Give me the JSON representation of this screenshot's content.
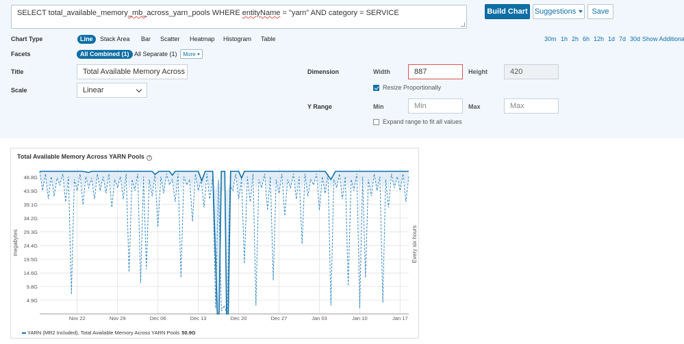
{
  "query": {
    "prefix": "SELECT total_available_memory",
    "squiggle1": "_mb_",
    "middle": "across_yarn_pools WHERE ",
    "squiggle2": "entityName",
    "suffix": " = \"yarn\" AND category = SERVICE"
  },
  "toolbar": {
    "build_label": "Build Chart",
    "suggestions_label": "Suggestions",
    "save_label": "Save"
  },
  "chart_type": {
    "label": "Chart Type",
    "options": [
      "Line",
      "Stack Area",
      "Bar",
      "Scatter",
      "Heatmap",
      "Histogram",
      "Table"
    ],
    "selected": "Line"
  },
  "time_ranges": [
    "30m",
    "1h",
    "2h",
    "6h",
    "12h",
    "1d",
    "7d",
    "30d"
  ],
  "show_additional": "Show Additional",
  "facets": {
    "label": "Facets",
    "combined": "All Combined (1)",
    "separate": "All Separate (1)",
    "more": "More"
  },
  "title_field": {
    "label": "Title",
    "value": "Total Available Memory Across YA"
  },
  "scale_field": {
    "label": "Scale",
    "value": "Linear"
  },
  "dimension": {
    "label": "Dimension",
    "width_label": "Width",
    "width_value": "887",
    "height_label": "Height",
    "height_value": "420",
    "resize_label": "Resize Proportionally",
    "resize_checked": true
  },
  "y_range": {
    "label": "Y Range",
    "min_label": "Min",
    "min_placeholder": "Min",
    "max_label": "Max",
    "max_placeholder": "Max",
    "expand_label": "Expand range to fit all values",
    "expand_checked": false
  },
  "colors": {
    "accent": "#0e6fa5",
    "panel_bg": "#f1f7fd",
    "invalid": "#d9534f"
  },
  "chart_data": {
    "type": "line",
    "title": "Total Available Memory Across YARN Pools",
    "ylabel": "megabytes",
    "right_label": "Every six hours",
    "y_ticks": [
      "4.9G",
      "9.8G",
      "14.6G",
      "19.5G",
      "24.4G",
      "29.3G",
      "34.2G",
      "39.1G",
      "43.9G",
      "48.8G"
    ],
    "y_tick_values": [
      4.9,
      9.8,
      14.6,
      19.5,
      24.4,
      29.3,
      34.2,
      39.1,
      43.9,
      48.8
    ],
    "ylim": [
      0,
      52
    ],
    "x_ticks": [
      "Nov 22",
      "Nov 29",
      "Dec 06",
      "Dec 13",
      "Dec 20",
      "Dec 27",
      "Jan 03",
      "Jan 10",
      "Jan 17"
    ],
    "x_tick_days": [
      22,
      29,
      36,
      43,
      50,
      57,
      64,
      71,
      78
    ],
    "xlim_days": [
      15.5,
      79.5
    ],
    "series": [
      {
        "name": "YARN (MR2 Included), Total Available Memory Across YARN Pools",
        "line": "max",
        "points": [
          [
            15.5,
            50.9
          ],
          [
            23,
            50.9
          ],
          [
            24,
            50.5
          ],
          [
            24.5,
            50.9
          ],
          [
            35,
            50.9
          ],
          [
            35.5,
            49.8
          ],
          [
            36.2,
            50.9
          ],
          [
            38,
            50.9
          ],
          [
            38.5,
            49.5
          ],
          [
            39,
            50.9
          ],
          [
            43,
            50.9
          ],
          [
            43.6,
            47.5
          ],
          [
            44.2,
            50.9
          ],
          [
            45.5,
            50.9
          ],
          [
            46.3,
            0
          ],
          [
            46.6,
            0
          ],
          [
            47,
            50.9
          ],
          [
            47.6,
            50.9
          ],
          [
            47.9,
            0
          ],
          [
            48.2,
            0
          ],
          [
            48.6,
            50.9
          ],
          [
            50,
            50.9
          ],
          [
            50.5,
            48.5
          ],
          [
            51,
            50.9
          ],
          [
            65,
            50.9
          ],
          [
            66,
            48
          ],
          [
            66.8,
            50.9
          ],
          [
            79.5,
            50.9
          ]
        ]
      },
      {
        "name": "Minimum",
        "line": "min-dashed",
        "points": [
          [
            15.5,
            50.9
          ],
          [
            16,
            44
          ],
          [
            16.5,
            50
          ],
          [
            17,
            41
          ],
          [
            17.5,
            49
          ],
          [
            18,
            42
          ],
          [
            18.5,
            48.5
          ],
          [
            19,
            46
          ],
          [
            19.5,
            50
          ],
          [
            20,
            40
          ],
          [
            20.5,
            49
          ],
          [
            21,
            7
          ],
          [
            21.5,
            48
          ],
          [
            22,
            44
          ],
          [
            22.5,
            50
          ],
          [
            23,
            39
          ],
          [
            23.5,
            49
          ],
          [
            24,
            45
          ],
          [
            24.5,
            48.5
          ],
          [
            25,
            41
          ],
          [
            25.5,
            50
          ],
          [
            26,
            44
          ],
          [
            26.5,
            49
          ],
          [
            27,
            43
          ],
          [
            27.5,
            50
          ],
          [
            28,
            38
          ],
          [
            28.5,
            48
          ],
          [
            29,
            45
          ],
          [
            29.5,
            49
          ],
          [
            30,
            41
          ],
          [
            30.5,
            50
          ],
          [
            31,
            15
          ],
          [
            31.5,
            48
          ],
          [
            32,
            44
          ],
          [
            32.5,
            50
          ],
          [
            33,
            11
          ],
          [
            33.5,
            49
          ],
          [
            34,
            16
          ],
          [
            34.5,
            48
          ],
          [
            35,
            42
          ],
          [
            35.5,
            50
          ],
          [
            36,
            31
          ],
          [
            36.5,
            49
          ],
          [
            37,
            43
          ],
          [
            37.5,
            50
          ],
          [
            38,
            46
          ],
          [
            38.5,
            48
          ],
          [
            39,
            40
          ],
          [
            39.5,
            50
          ],
          [
            40,
            13
          ],
          [
            40.5,
            49
          ],
          [
            41,
            46
          ],
          [
            41.5,
            48
          ],
          [
            42,
            33
          ],
          [
            42.5,
            50
          ],
          [
            43,
            44
          ],
          [
            43.5,
            48
          ],
          [
            44,
            38
          ],
          [
            44.5,
            50
          ],
          [
            45,
            41
          ],
          [
            45.5,
            49
          ],
          [
            46,
            2
          ],
          [
            46.5,
            48
          ],
          [
            47,
            1
          ],
          [
            47.5,
            3
          ],
          [
            48,
            0
          ],
          [
            48.5,
            46
          ],
          [
            49,
            44
          ],
          [
            49.5,
            50
          ],
          [
            50,
            41
          ],
          [
            50.5,
            48
          ],
          [
            51,
            18
          ],
          [
            51.5,
            49
          ],
          [
            52,
            40
          ],
          [
            52.5,
            50
          ],
          [
            53,
            3
          ],
          [
            53.5,
            48
          ],
          [
            54,
            45
          ],
          [
            54.5,
            50
          ],
          [
            55,
            37
          ],
          [
            55.5,
            49
          ],
          [
            56,
            12
          ],
          [
            56.5,
            48
          ],
          [
            57,
            43
          ],
          [
            57.5,
            50
          ],
          [
            58,
            35
          ],
          [
            58.5,
            48
          ],
          [
            59,
            45
          ],
          [
            59.5,
            50
          ],
          [
            60,
            41
          ],
          [
            60.5,
            49
          ],
          [
            61,
            25
          ],
          [
            61.5,
            50
          ],
          [
            62,
            42
          ],
          [
            62.5,
            48
          ],
          [
            63,
            46
          ],
          [
            63.5,
            50
          ],
          [
            64,
            37
          ],
          [
            64.5,
            49
          ],
          [
            65,
            43
          ],
          [
            65.5,
            50
          ],
          [
            66,
            3
          ],
          [
            66.5,
            48
          ],
          [
            67,
            45
          ],
          [
            67.5,
            50
          ],
          [
            68,
            41
          ],
          [
            68.5,
            49
          ],
          [
            69,
            10
          ],
          [
            69.5,
            48
          ],
          [
            70,
            44
          ],
          [
            70.5,
            50
          ],
          [
            71,
            2
          ],
          [
            71.5,
            49
          ],
          [
            72,
            13
          ],
          [
            72.5,
            48
          ],
          [
            73,
            42
          ],
          [
            73.5,
            50
          ],
          [
            74,
            44
          ],
          [
            74.5,
            49
          ],
          [
            75,
            4
          ],
          [
            75.5,
            48
          ],
          [
            76,
            38
          ],
          [
            76.5,
            50
          ],
          [
            77,
            45
          ],
          [
            77.5,
            49
          ],
          [
            78,
            44
          ],
          [
            78.5,
            50
          ],
          [
            79,
            40
          ],
          [
            79.5,
            49
          ]
        ]
      }
    ],
    "legend_label": "YARN (MR2 Included), Total Available Memory Across YARN Pools",
    "legend_value": "50.9G"
  }
}
